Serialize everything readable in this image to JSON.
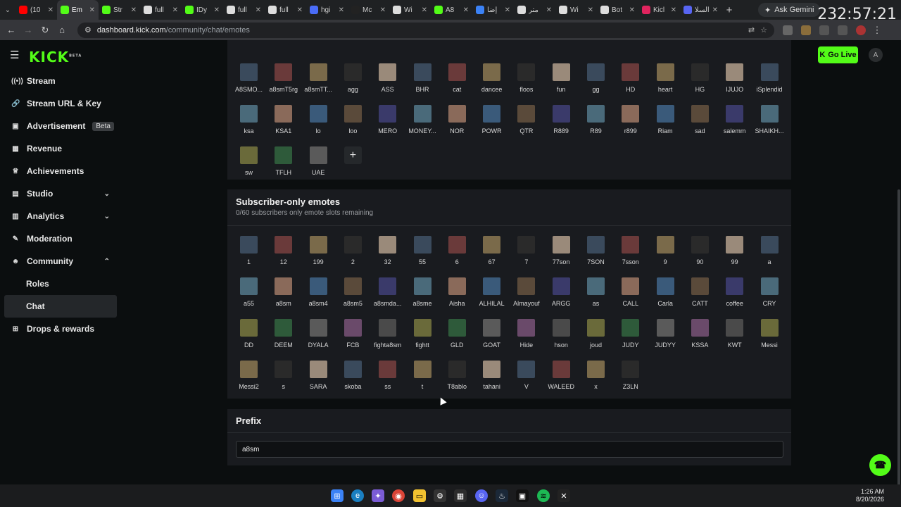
{
  "browser": {
    "tabs": [
      {
        "title": "(10",
        "fav_color": "#ff0000"
      },
      {
        "title": "Em",
        "fav_color": "#53fc18",
        "active": true
      },
      {
        "title": "Str",
        "fav_color": "#53fc18"
      },
      {
        "title": "full",
        "fav_color": "#dddddd"
      },
      {
        "title": "IDy",
        "fav_color": "#53fc18"
      },
      {
        "title": "full",
        "fav_color": "#dddddd"
      },
      {
        "title": "full",
        "fav_color": "#dddddd"
      },
      {
        "title": "hgi",
        "fav_color": "#4a6cf7"
      },
      {
        "title": "Mc",
        "fav_color": "#222222"
      },
      {
        "title": "Wi",
        "fav_color": "#dddddd"
      },
      {
        "title": "A8",
        "fav_color": "#53fc18"
      },
      {
        "title": "إضا",
        "fav_color": "#3b82f6"
      },
      {
        "title": "متر",
        "fav_color": "#dddddd"
      },
      {
        "title": "Wi",
        "fav_color": "#dddddd"
      },
      {
        "title": "Bot",
        "fav_color": "#dddddd"
      },
      {
        "title": "Kicl",
        "fav_color": "#e0245e"
      },
      {
        "title": "السلا",
        "fav_color": "#5865f2"
      }
    ],
    "new_tab": "+",
    "gemini_label": "Ask Gemini",
    "clock_overlay": "232:57:21",
    "url_host": "dashboard.kick.com",
    "url_path": "/community/chat/emotes"
  },
  "app": {
    "logo": "KICK",
    "logo_badge": "BETA",
    "go_live": "Go Live",
    "avatar_letter": "A"
  },
  "sidebar": {
    "items": [
      {
        "label": "Stream",
        "icon": "signal-icon",
        "glyph": "((•))"
      },
      {
        "label": "Stream URL & Key",
        "icon": "link-icon",
        "glyph": "🔗"
      },
      {
        "label": "Advertisement",
        "icon": "ad-icon",
        "glyph": "▣",
        "badge": "Beta"
      },
      {
        "label": "Revenue",
        "icon": "chart-icon",
        "glyph": "▦"
      },
      {
        "label": "Achievements",
        "icon": "trophy-icon",
        "glyph": "♕"
      },
      {
        "label": "Studio",
        "icon": "studio-icon",
        "glyph": "▤",
        "chevron": "down"
      },
      {
        "label": "Analytics",
        "icon": "analytics-icon",
        "glyph": "▥",
        "chevron": "down"
      },
      {
        "label": "Moderation",
        "icon": "wrench-icon",
        "glyph": "✎"
      },
      {
        "label": "Community",
        "icon": "people-icon",
        "glyph": "☻",
        "chevron": "up"
      },
      {
        "label": "Roles",
        "sub": true
      },
      {
        "label": "Chat",
        "sub": true,
        "active": true
      },
      {
        "label": "Drops & rewards",
        "icon": "gift-icon",
        "glyph": "⊞"
      }
    ]
  },
  "global_emotes": {
    "rows": [
      [
        "A8SMO...",
        "a8smT5rg",
        "a8smTT...",
        "agg",
        "ASS",
        "BHR",
        "cat",
        "dancee",
        "floos",
        "fun",
        "gg",
        "HD",
        "heart",
        "HG",
        "IJUJO",
        "iSplendid"
      ],
      [
        "ksa",
        "KSA1",
        "lo",
        "loo",
        "MERO",
        "MONEY...",
        "NOR",
        "POWR",
        "QTR",
        "R889",
        "R89",
        "r899",
        "Riam",
        "sad",
        "salemm",
        "SHAIKH..."
      ],
      [
        "sw",
        "TFLH",
        "UAE"
      ]
    ],
    "add_label": "+"
  },
  "subscriber_emotes": {
    "title": "Subscriber-only emotes",
    "subtitle": "0/60 subscribers only emote slots remaining",
    "rows": [
      [
        "1",
        "12",
        "199",
        "2",
        "32",
        "55",
        "6",
        "67",
        "7",
        "77son",
        "7SON",
        "7sson",
        "9",
        "90",
        "99",
        "a"
      ],
      [
        "a55",
        "a8sm",
        "a8sm4",
        "a8sm5",
        "a8smda...",
        "a8sme",
        "Aisha",
        "ALHILAL",
        "Almayouf",
        "ARGG",
        "as",
        "CALL",
        "Carla",
        "CATT",
        "coffee",
        "CRY"
      ],
      [
        "DD",
        "DEEM",
        "DYALA",
        "FCB",
        "fighta8sm",
        "fightt",
        "GLD",
        "GOAT",
        "Hide",
        "hson",
        "joud",
        "JUDY",
        "JUDYY",
        "KSSA",
        "KWT",
        "Messi"
      ],
      [
        "Messi2",
        "s",
        "SARA",
        "skoba",
        "ss",
        "t",
        "T8ablo",
        "tahani",
        "V",
        "WALEED",
        "x",
        "Z3LN"
      ]
    ]
  },
  "prefix": {
    "title": "Prefix",
    "value": "a8sm"
  },
  "taskbar": {
    "time": "1:26 AM",
    "date": "8/20/2026"
  },
  "colors": {
    "accent": "#53fc18",
    "panel": "#191b1f",
    "background": "#0b0e0f"
  }
}
